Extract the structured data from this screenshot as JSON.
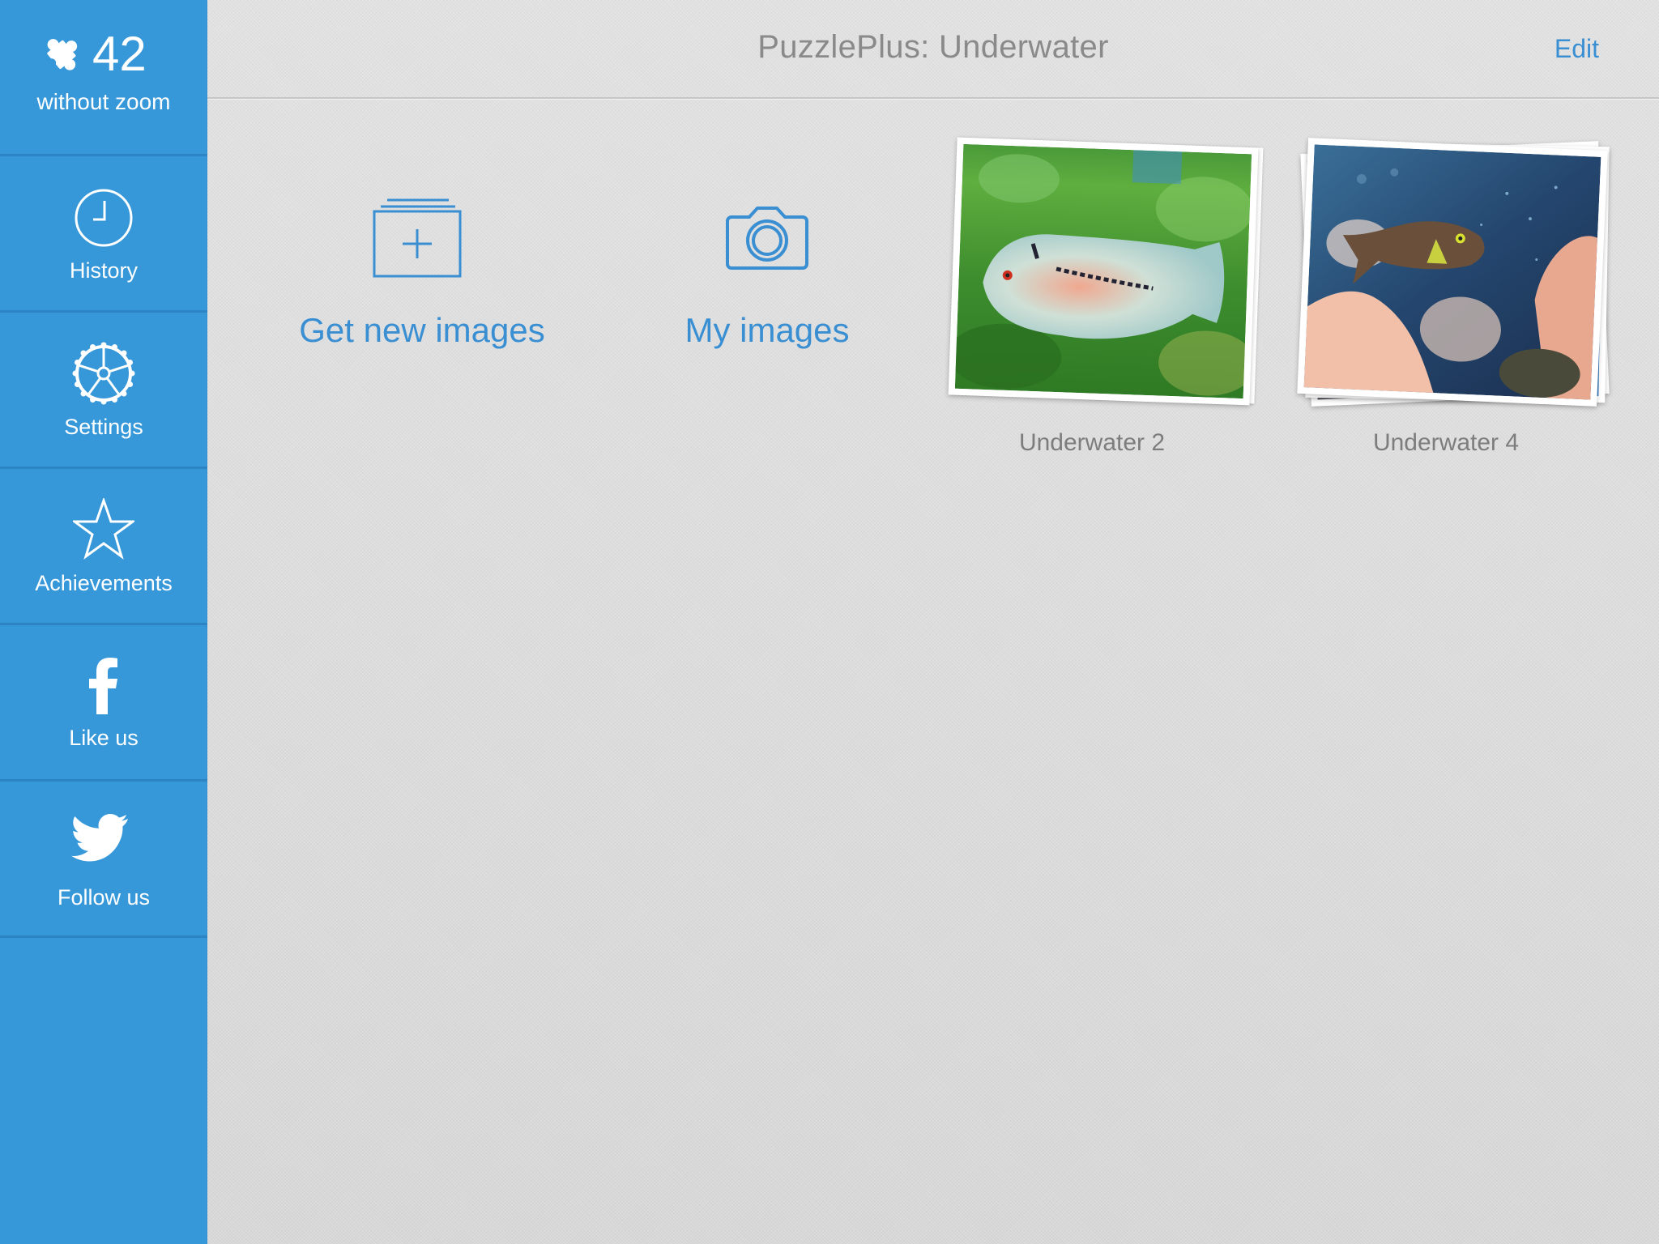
{
  "header": {
    "title": "PuzzlePlus: Underwater",
    "edit_label": "Edit"
  },
  "sidebar": {
    "score": {
      "icon": "puzzle-piece-icon",
      "value": "42",
      "caption": "without zoom"
    },
    "items": [
      {
        "icon": "clock-icon",
        "label": "History"
      },
      {
        "icon": "gear-icon",
        "label": "Settings"
      },
      {
        "icon": "star-icon",
        "label": "Achievements"
      },
      {
        "icon": "facebook-icon",
        "label": "Like us"
      },
      {
        "icon": "twitter-icon",
        "label": "Follow us"
      }
    ]
  },
  "actions": [
    {
      "icon": "add-images-icon",
      "label": "Get new images"
    },
    {
      "icon": "camera-icon",
      "label": "My images"
    }
  ],
  "puzzles": [
    {
      "label": "Underwater 2",
      "stacked": false
    },
    {
      "label": "Underwater 4",
      "stacked": true
    }
  ],
  "colors": {
    "sidebar": "#3697d9",
    "accent": "#3a8fd3",
    "title_gray": "#8a8a8a",
    "background": "#dedede"
  }
}
